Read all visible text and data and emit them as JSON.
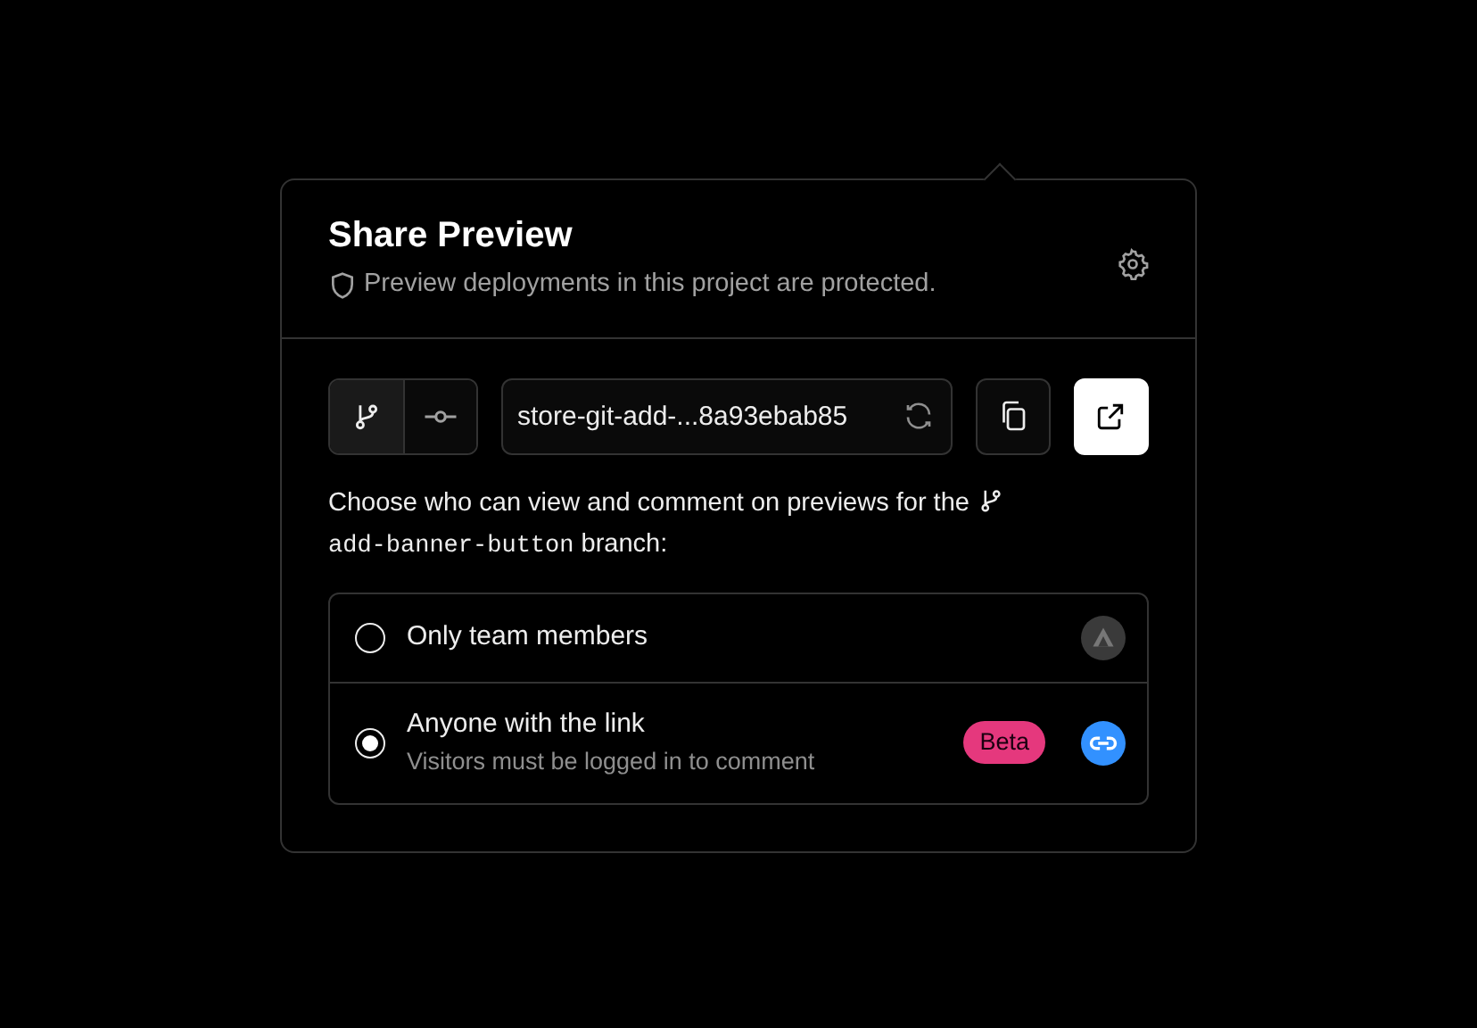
{
  "title": "Share Preview",
  "subtitle": "Preview deployments in this project are protected.",
  "mode_toggle": [
    {
      "kind": "branch",
      "selected": true
    },
    {
      "kind": "commit",
      "selected": false
    }
  ],
  "url_field": {
    "value": "store-git-add-...8a93ebab85"
  },
  "description": {
    "before": "Choose who can view and comment on previews for the",
    "branch": "add-banner-button",
    "after": "branch:"
  },
  "options": [
    {
      "kind": "team",
      "label": "Only team members",
      "selected": false
    },
    {
      "kind": "link",
      "label": "Anyone with the link",
      "hint": "Visitors must be logged in to comment",
      "badge": "Beta",
      "selected": true
    }
  ]
}
